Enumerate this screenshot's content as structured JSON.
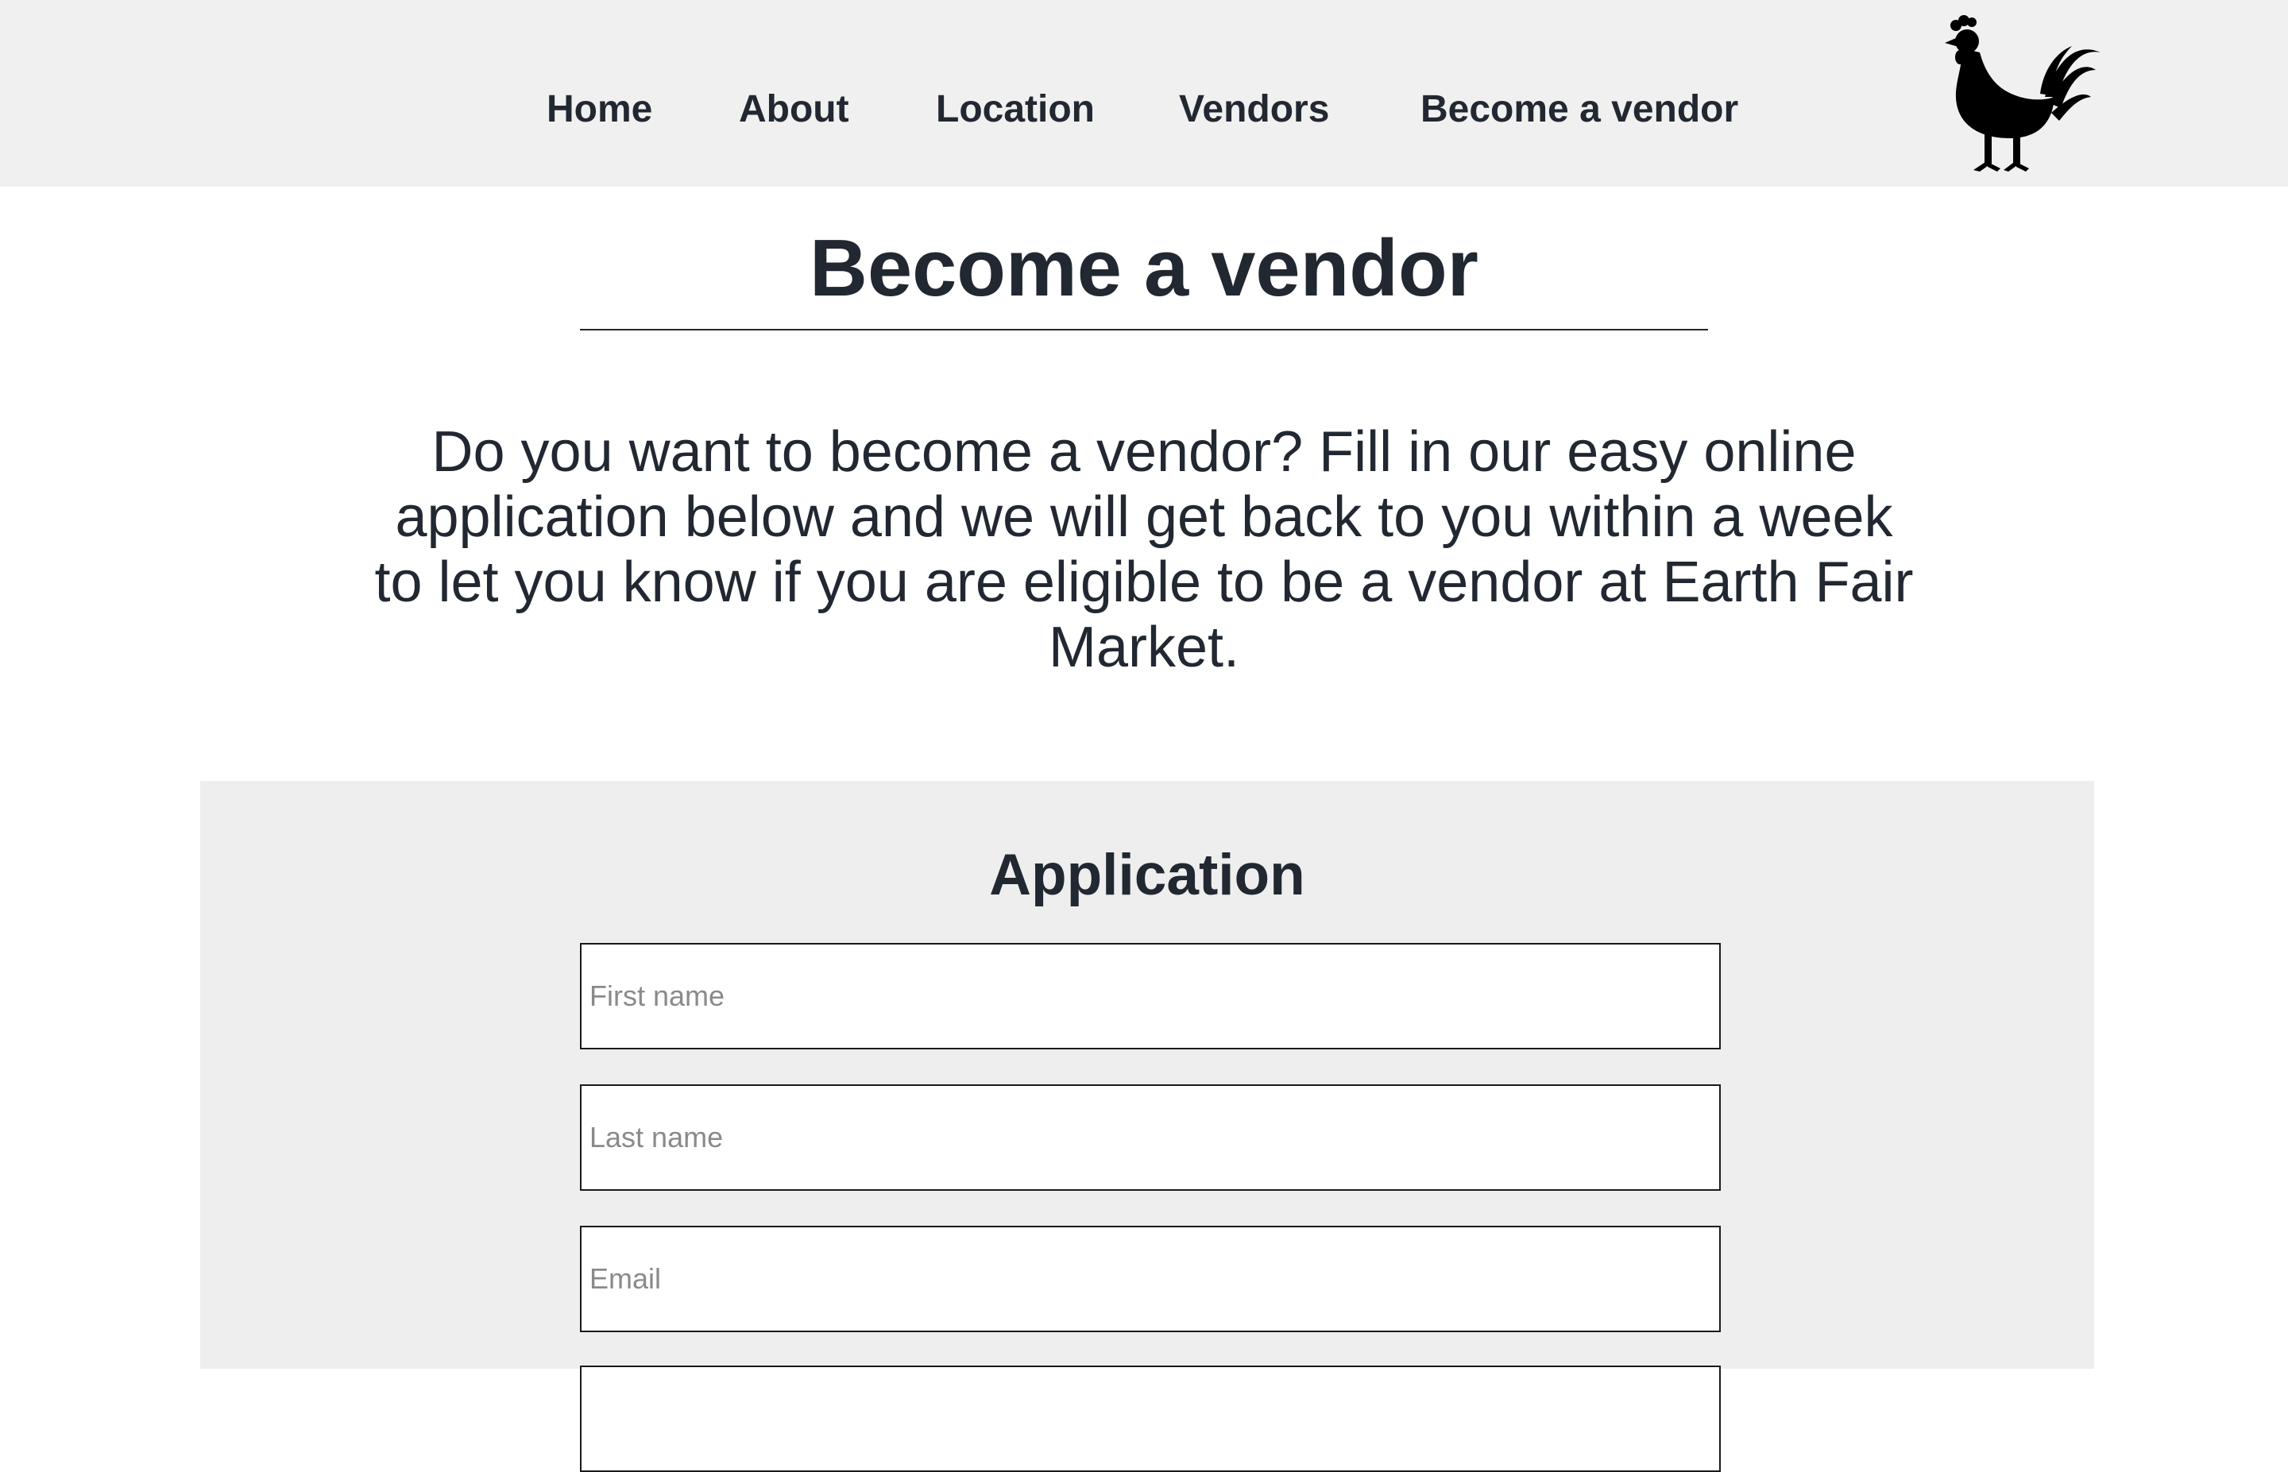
{
  "nav": {
    "items": [
      {
        "label": "Home"
      },
      {
        "label": "About"
      },
      {
        "label": "Location"
      },
      {
        "label": "Vendors"
      },
      {
        "label": "Become a vendor"
      }
    ],
    "logo_icon": "rooster-icon"
  },
  "page": {
    "title": "Become a vendor",
    "intro": "Do you want to become a vendor? Fill in our easy online application below and we will get back to you within a week to let you know if you are eligible to be a vendor at Earth Fair Market."
  },
  "application": {
    "title": "Application",
    "fields": [
      {
        "placeholder": "First name",
        "value": ""
      },
      {
        "placeholder": "Last name",
        "value": ""
      },
      {
        "placeholder": "Email",
        "value": ""
      },
      {
        "placeholder": "",
        "value": ""
      }
    ]
  },
  "colors": {
    "text": "#222831",
    "navbar_bg": "#f0f0f0",
    "panel_bg": "#eeeeee"
  }
}
